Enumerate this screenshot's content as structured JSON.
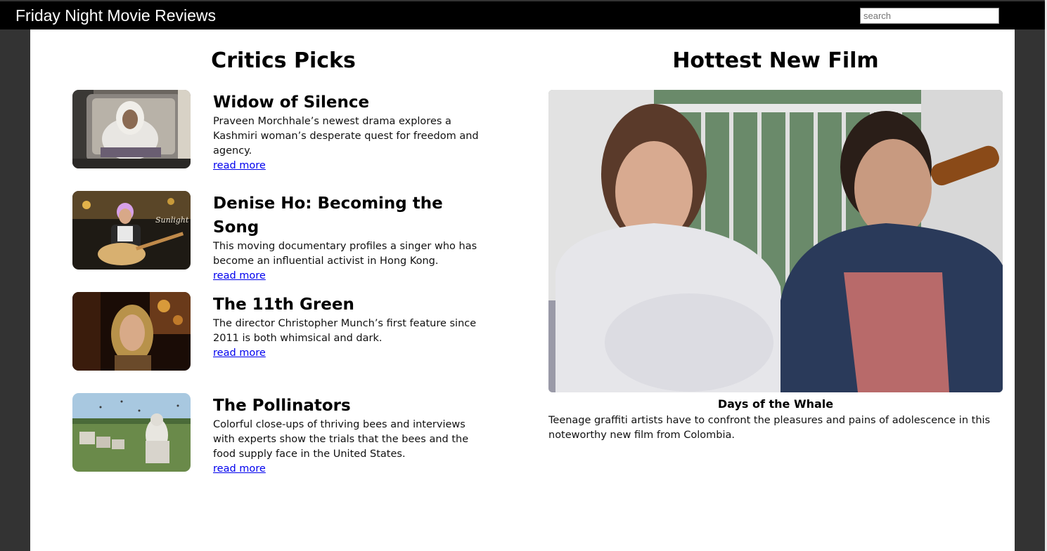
{
  "header": {
    "site_title": "Friday Night Movie Reviews",
    "search_placeholder": "search"
  },
  "critics_picks": {
    "heading": "Critics Picks",
    "items": [
      {
        "title": "Widow of Silence",
        "description": "Praveen Morchhale’s newest drama explores a Kashmiri woman’s desperate quest for freedom and agency.",
        "link_label": "read more"
      },
      {
        "title": "Denise Ho: Becoming the Song",
        "description": "This moving documentary profiles a singer who has become an influential activist in Hong Kong.",
        "link_label": "read more"
      },
      {
        "title": "The 11th Green",
        "description": "The director Christopher Munch’s first feature since 2011 is both whimsical and dark.",
        "link_label": "read more"
      },
      {
        "title": "The Pollinators",
        "description": "Colorful close-ups of thriving bees and interviews with experts show the trials that the bees and the food supply face in the United States.",
        "link_label": "read more"
      }
    ]
  },
  "hottest_new_film": {
    "heading": "Hottest New Film",
    "film_title": "Days of the Whale",
    "description": "Teenage graffiti artists have to confront the pleasures and pains of adolescence in this noteworthy new film from Colombia."
  },
  "colors": {
    "header_bg": "#000000",
    "page_bg": "#333333",
    "content_bg": "#ffffff",
    "link": "#0000ee"
  }
}
